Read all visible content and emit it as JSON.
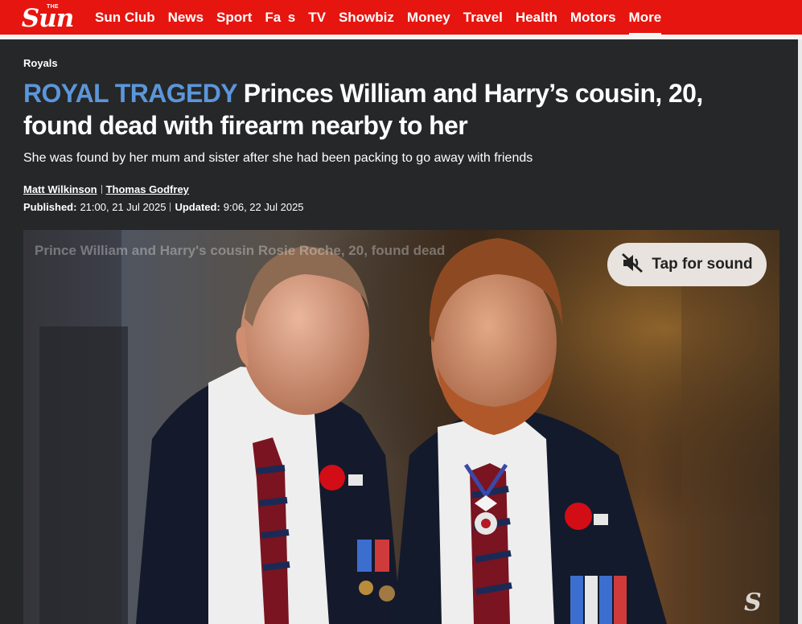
{
  "nav": {
    "logo_small": "THE",
    "logo_main": "Sun",
    "items": [
      "Sun Club",
      "News",
      "Sport",
      "Fa   s",
      "TV",
      "Showbiz",
      "Money",
      "Travel",
      "Health",
      "Motors",
      "More"
    ]
  },
  "article": {
    "category": "Royals",
    "kicker": "ROYAL TRAGEDY",
    "headline": "Princes William and Harry’s cousin, 20, found dead with firearm nearby to her",
    "standfirst": "She was found by her mum and sister after she had been packing to go away with friends",
    "authors": [
      "Matt Wilkinson",
      "Thomas Godfrey"
    ],
    "published_label": "Published:",
    "published_value": "21:00, 21 Jul 2025",
    "updated_label": "Updated:",
    "updated_value": "9:06, 22 Jul 2025"
  },
  "video": {
    "watermark_text": "Prince William and Harry's cousin Rosie Roche, 20, found dead",
    "sound_button_label": "Tap for sound",
    "sound_icon": "speaker-muted-icon",
    "corner_logo": "S"
  },
  "colors": {
    "brand_red": "#e6150f",
    "kicker_blue": "#5b96db",
    "background": "#262728"
  }
}
